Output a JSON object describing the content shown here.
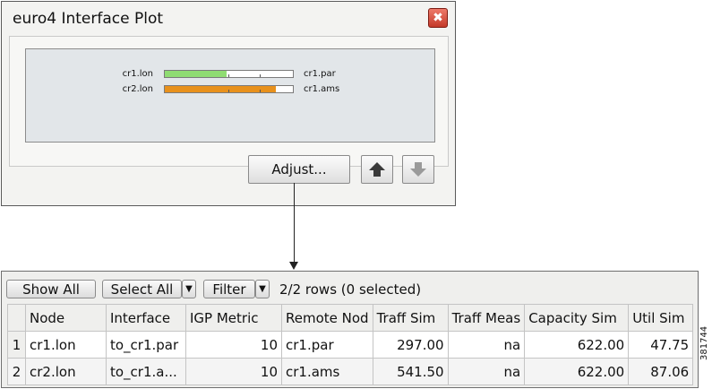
{
  "window": {
    "title": "euro4 Interface Plot",
    "close_glyph": "✖",
    "plot_rows": [
      {
        "left_label": "cr1.lon",
        "right_label": "cr1.par",
        "utilization": 0.48,
        "color": "#8fdc72"
      },
      {
        "left_label": "cr2.lon",
        "right_label": "cr1.ams",
        "utilization": 0.87,
        "color": "#e8911c"
      }
    ],
    "adjust_label": "Adjust...",
    "up_icon": "up-arrow-icon",
    "down_icon": "down-arrow-icon",
    "up_color": "#3a3a3a",
    "down_color": "#9a9a9a"
  },
  "table_panel": {
    "show_all_label": "Show All",
    "select_all_label": "Select All",
    "filter_label": "Filter",
    "dropdown_glyph": "▼",
    "row_status": "2/2 rows (0 selected)",
    "columns": [
      "Node",
      "Interface",
      "IGP Metric",
      "Remote Nod",
      "Traff Sim",
      "Traff Meas",
      "Capacity Sim",
      "Util Sim"
    ],
    "rows": [
      {
        "index": "1",
        "node": "cr1.lon",
        "interface": "to_cr1.par",
        "igp_metric": "10",
        "remote_node": "cr1.par",
        "traff_sim": "297.00",
        "traff_meas": "na",
        "capacity_sim": "622.00",
        "util_sim": "47.75"
      },
      {
        "index": "2",
        "node": "cr2.lon",
        "interface": "to_cr1.a...",
        "igp_metric": "10",
        "remote_node": "cr1.ams",
        "traff_sim": "541.50",
        "traff_meas": "na",
        "capacity_sim": "622.00",
        "util_sim": "87.06"
      }
    ]
  },
  "figure_id": "381744"
}
